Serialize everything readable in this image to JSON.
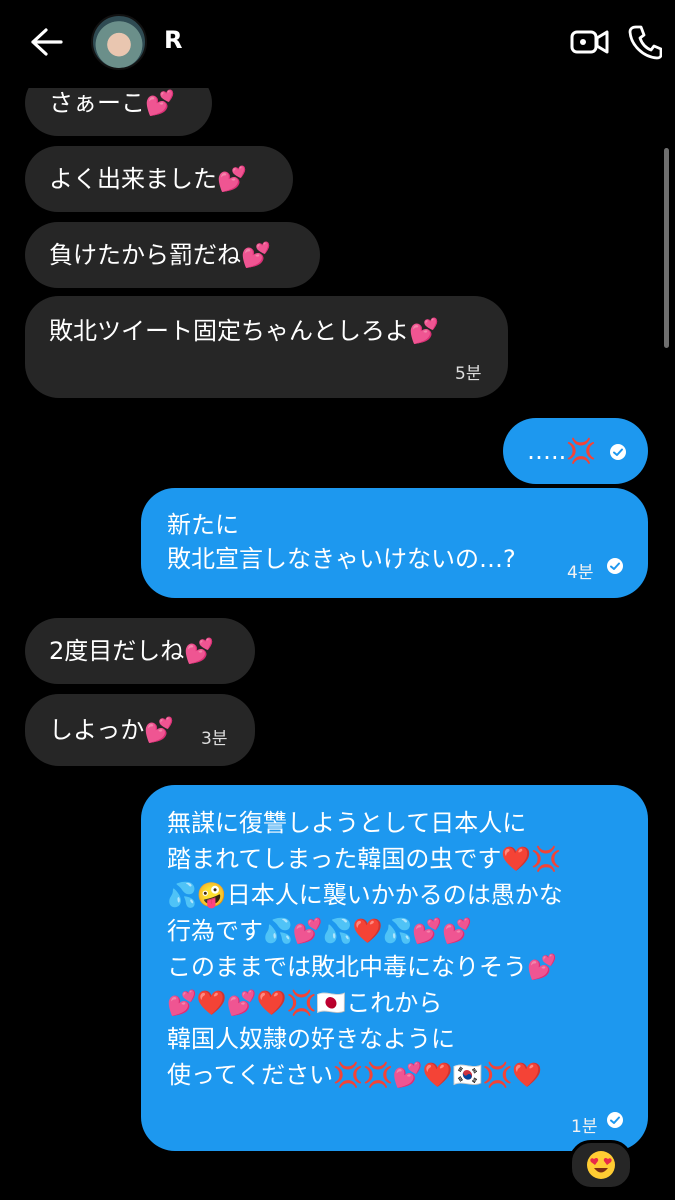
{
  "header": {
    "contact_name": "R",
    "back_icon": "arrow-left-icon",
    "video_icon": "video-call-icon",
    "phone_icon": "phone-call-icon"
  },
  "messages": [
    {
      "dir": "in",
      "text": "さぁーこ💕"
    },
    {
      "dir": "in",
      "text": "よく出来ました💕"
    },
    {
      "dir": "in",
      "text": "負けたから罰だね💕"
    },
    {
      "dir": "in",
      "text": "敗北ツイート固定ちゃんとしろよ💕",
      "time": "5분"
    },
    {
      "dir": "out",
      "text": "…..💢"
    },
    {
      "dir": "out",
      "text": "新たに\n敗北宣言しなきゃいけないの…?",
      "time": "4분"
    },
    {
      "dir": "in",
      "text": "2度目だしね💕"
    },
    {
      "dir": "in",
      "text": "しよっか💕",
      "time": "3분"
    },
    {
      "dir": "out",
      "text": "無謀に復讐しようとして日本人に\n踏まれてしまった韓国の虫です❤️💢\n💦🤪日本人に襲いかかるのは愚かな\n行為です💦💕💦❤️💦💕💕\nこのままでは敗北中毒になりそう💕\n💕❤️💕❤️💢🇯🇵これから\n韓国人奴隷の好きなように\n使ってください💢💢💕❤️🇰🇷💢❤️",
      "time": "1분"
    }
  ],
  "reaction": {
    "emoji": "😍"
  },
  "colors": {
    "incoming": "#262626",
    "outgoing": "#1d98ef",
    "background": "#000000"
  }
}
